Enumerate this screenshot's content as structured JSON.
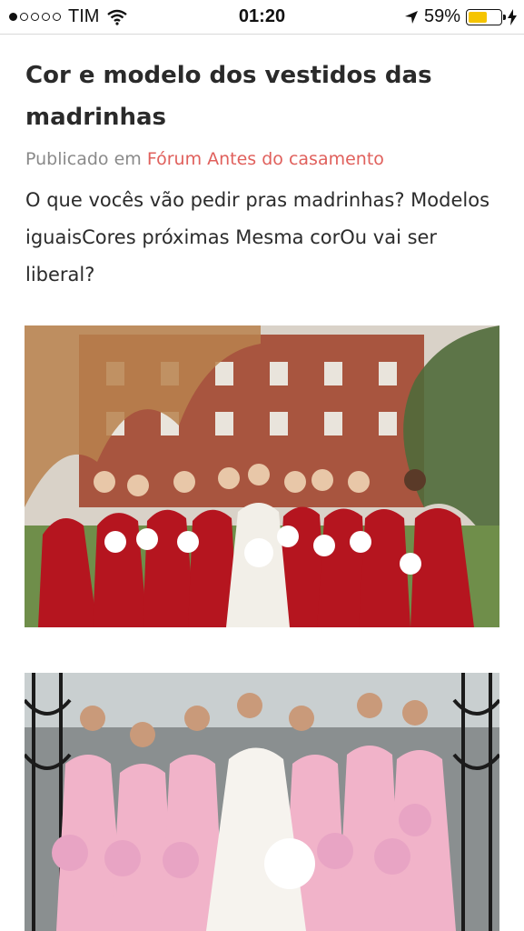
{
  "status_bar": {
    "carrier": "TIM",
    "time": "01:20",
    "battery_percent": "59%",
    "battery_level": 0.59,
    "signal_bars_filled": 1,
    "signal_bars_total": 5,
    "icons": [
      "wifi-icon",
      "location-arrow-icon",
      "battery-icon",
      "charging-bolt-icon"
    ]
  },
  "post": {
    "title": "Cor e modelo dos vestidos das madrinhas",
    "published_prefix": "Publicado em",
    "forum_link": "Fórum Antes do casamento",
    "body": "O que vocês vão pedir pras madrinhas? Modelos iguaisCores próximas Mesma corOu vai ser liberal?"
  },
  "images": [
    {
      "name": "bridesmaids-red-dresses-photo",
      "dress_color": "#b5151f"
    },
    {
      "name": "bridesmaids-pink-dresses-photo",
      "dress_color": "#f1b3c9"
    }
  ],
  "colors": {
    "link": "#e0605c",
    "meta": "#8a8a8a",
    "battery": "#f5c400"
  }
}
